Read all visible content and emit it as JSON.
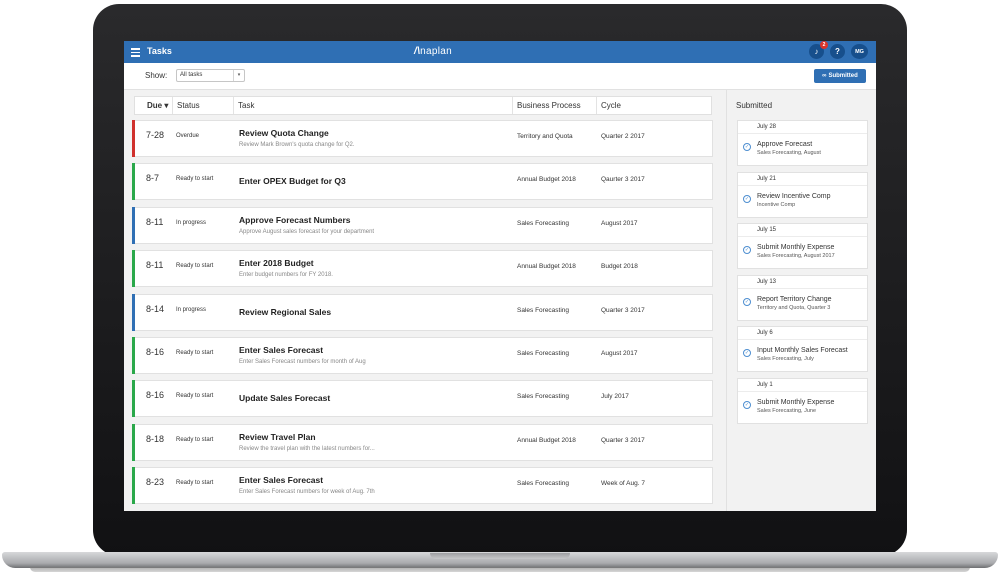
{
  "app": {
    "title": "Tasks",
    "brand_mark": "/\\",
    "brand_text": "naplan",
    "bell_badge": "2",
    "help_label": "?",
    "avatar_initials": "MG"
  },
  "toolbar": {
    "show_label": "Show:",
    "filter_value": "All tasks",
    "submitted_button": "Submitted"
  },
  "table": {
    "columns": [
      "Due ▾",
      "Status",
      "Task",
      "Business Process",
      "Cycle"
    ],
    "rows": [
      {
        "due": "7-28",
        "status": "Overdue",
        "title": "Review Quota Change",
        "desc": "Review Mark Brown's quota change for Q2.",
        "process": "Territory and Quota",
        "cycle": "Quarter 2 2017",
        "color": "#d0312d"
      },
      {
        "due": "8-7",
        "status": "Ready to start",
        "title": "Enter OPEX Budget for Q3",
        "desc": "",
        "process": "Annual Budget 2018",
        "cycle": "Qaurter 3 2017",
        "color": "#2aa84a"
      },
      {
        "due": "8-11",
        "status": "In progress",
        "title": "Approve Forecast Numbers",
        "desc": "Approve August sales forecast for your department",
        "process": "Sales Forecasting",
        "cycle": "August 2017",
        "color": "#2f6fb4"
      },
      {
        "due": "8-11",
        "status": "Ready to start",
        "title": "Enter 2018 Budget",
        "desc": "Enter budget numbers for FY 2018.",
        "process": "Annual Budget 2018",
        "cycle": "Budget 2018",
        "color": "#2aa84a"
      },
      {
        "due": "8-14",
        "status": "In progress",
        "title": "Review Regional Sales",
        "desc": "",
        "process": "Sales Forecasting",
        "cycle": "Quarter 3 2017",
        "color": "#2f6fb4"
      },
      {
        "due": "8-16",
        "status": "Ready to start",
        "title": "Enter Sales Forecast",
        "desc": "Enter Sales Forecast numbers for month of Aug",
        "process": "Sales Forecasting",
        "cycle": "August 2017",
        "color": "#2aa84a"
      },
      {
        "due": "8-16",
        "status": "Ready to start",
        "title": "Update Sales Forecast",
        "desc": "",
        "process": "Sales Forecasting",
        "cycle": "July 2017",
        "color": "#2aa84a"
      },
      {
        "due": "8-18",
        "status": "Ready to start",
        "title": "Review Travel Plan",
        "desc": "Review the travel plan with the latest numbers for...",
        "process": "Annual Budget 2018",
        "cycle": "Quarter 3 2017",
        "color": "#2aa84a"
      },
      {
        "due": "8-23",
        "status": "Ready to start",
        "title": "Enter Sales Forecast",
        "desc": "Enter Sales Forecast numbers for week of Aug. 7th",
        "process": "Sales Forecasting",
        "cycle": "Week of Aug. 7",
        "color": "#2aa84a"
      }
    ]
  },
  "submitted": {
    "title": "Submitted",
    "items": [
      {
        "date": "July 28",
        "title": "Approve Forecast",
        "sub": "Sales Forecasting, August"
      },
      {
        "date": "July 21",
        "title": "Review Incentive Comp",
        "sub": "Incentive Comp"
      },
      {
        "date": "July 15",
        "title": "Submit Monthly Expense",
        "sub": "Sales Forecasting, August 2017"
      },
      {
        "date": "July 13",
        "title": "Report Territory Change",
        "sub": "Territory and Quota, Quarter 3"
      },
      {
        "date": "July 6",
        "title": "Input Monthly Sales Forecast",
        "sub": "Sales Forecasting, July"
      },
      {
        "date": "July 1",
        "title": "Submit Monthly Expense",
        "sub": "Sales Forecasting, June"
      }
    ]
  }
}
